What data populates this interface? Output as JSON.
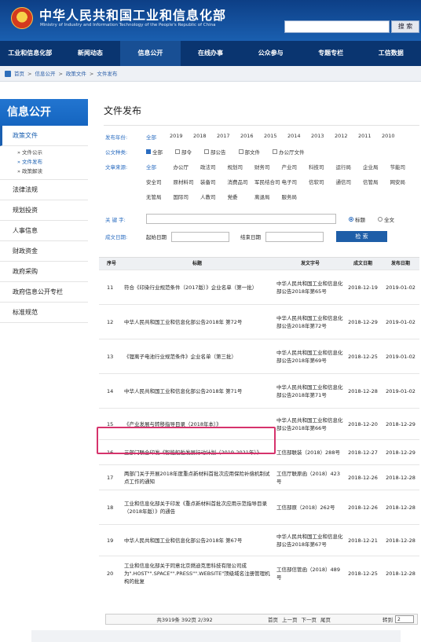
{
  "header": {
    "title": "中华人民共和国工业和信息化部",
    "subtitle": "Ministry of Industry and Information Technology of the People's Republic of China",
    "search_label": "搜 索"
  },
  "nav": [
    "工业和信息化部",
    "新闻动态",
    "信息公开",
    "在线办事",
    "公众参与",
    "专题专栏",
    "工信数据"
  ],
  "breadcrumb": [
    "首页",
    "信息公开",
    "政策文件",
    "文件发布"
  ],
  "sidebar": {
    "heading": "信息公开",
    "items": [
      "政策文件",
      "法律法规",
      "规划投资",
      "人事信息",
      "财政资金",
      "政府采购",
      "政府信息公开专栏",
      "标准规范"
    ],
    "sub_items": [
      "» 文件公示",
      "» 文件发布",
      "» 政策解读"
    ]
  },
  "main": {
    "title": "文件发布",
    "year_label": "发布年份:",
    "years": [
      "全部",
      "2019",
      "2018",
      "2017",
      "2016",
      "2015",
      "2014",
      "2013",
      "2012",
      "2011",
      "2010"
    ],
    "type_label": "公文种类:",
    "types": [
      "全部",
      "部令",
      "部公告",
      "部文件",
      "办公厅文件"
    ],
    "source_label": "文章来源:",
    "sources": [
      "全部",
      "办公厅",
      "政法司",
      "规划司",
      "财务司",
      "产业司",
      "科技司",
      "运行局",
      "企业局",
      "节能司",
      "安全司",
      "原材料司",
      "装备司",
      "消费品司",
      "军民结合司",
      "电子司",
      "信软司",
      "通信司",
      "信管局",
      "网安局",
      "无管局",
      "国际司",
      "人教司",
      "党委",
      "离退局",
      "服务局"
    ],
    "keyword_label": "关 键 字:",
    "radio_title": "标题",
    "radio_full": "全文",
    "date_label": "成文日期:",
    "start_label": "起始日期",
    "end_label": "结束日期",
    "search_button": "检 索"
  },
  "table": {
    "headers": [
      "序号",
      "标题",
      "发文字号",
      "成文日期",
      "发布日期"
    ],
    "rows": [
      {
        "no": "11",
        "title": "符合《印染行业规范条件（2017版）》企业名单（第一批）",
        "doc": "中华人民共和国工业和信息化部公告2018年第65号",
        "d1": "2018-12-19",
        "d2": "2019-01-02"
      },
      {
        "no": "12",
        "title": "中华人民共和国工业和信息化部公告2018年 第72号",
        "doc": "中华人民共和国工业和信息化部公告2018年第72号",
        "d1": "2018-12-29",
        "d2": "2019-01-02"
      },
      {
        "no": "13",
        "title": "《锂离子电池行业规范条件》企业名单（第三批）",
        "doc": "中华人民共和国工业和信息化部公告2018年第69号",
        "d1": "2018-12-25",
        "d2": "2019-01-02"
      },
      {
        "no": "14",
        "title": "中华人民共和国工业和信息化部公告2018年 第71号",
        "doc": "中华人民共和国工业和信息化部公告2018年第71号",
        "d1": "2018-12-28",
        "d2": "2019-01-02"
      },
      {
        "no": "15",
        "title": "《产业发展与转移指导目录（2018年本）》",
        "doc": "中华人民共和国工业和信息化部公告2018年第66号",
        "d1": "2018-12-20",
        "d2": "2018-12-29"
      },
      {
        "no": "16",
        "title": "三部门联合印发《智能船舶发展行动计划（2019-2021年）》",
        "doc": "工信部联装（2018）288号",
        "d1": "2018-12-27",
        "d2": "2018-12-29"
      },
      {
        "no": "17",
        "title": "两部门关于开展2018年度重点新材料首批次应用保险补偿机制试点工作的通知",
        "doc": "工信厅联原函（2018）423号",
        "d1": "2018-12-26",
        "d2": "2018-12-28"
      },
      {
        "no": "18",
        "title": "工业和信息化部关于印发《重点新材料首批次应用示范指导目录（2018年版）》的通告",
        "doc": "工信部原（2018）262号",
        "d1": "2018-12-26",
        "d2": "2018-12-28"
      },
      {
        "no": "19",
        "title": "中华人民共和国工业和信息化部公告2018年 第67号",
        "doc": "中华人民共和国工业和信息化部公告2018年第67号",
        "d1": "2018-12-21",
        "d2": "2018-12-28"
      },
      {
        "no": "20",
        "title": "工业和信息化部关于同意北京燃迪克思科技有限公司成为\".HOST\"\".SPACE\"\".PRESS\"\".WEBSITE\"顶级域名注册管理机构的批复",
        "doc": "工信部信管函（2018）489号",
        "d1": "2018-12-25",
        "d2": "2018-12-28"
      }
    ]
  },
  "pager": {
    "info": "共3919条 392页 2/392",
    "first": "首页",
    "prev": "上一页",
    "next": "下一页",
    "last": "尾页",
    "goto_label": "转到",
    "goto_value": "2"
  }
}
